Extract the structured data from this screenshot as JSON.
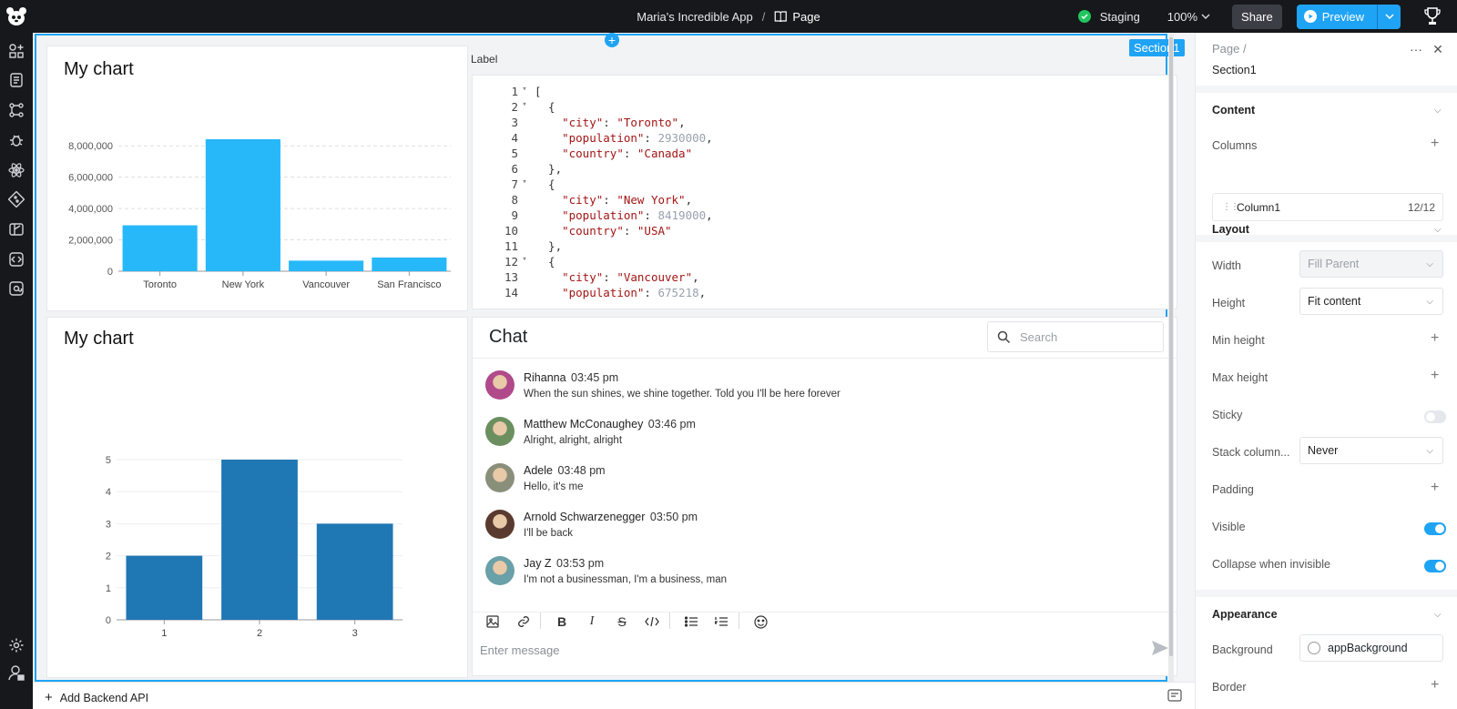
{
  "topbar": {
    "app_name": "Maria's Incredible App",
    "separator": "/",
    "page_name": "Page",
    "environment": "Staging",
    "zoom": "100%",
    "share_label": "Share",
    "preview_label": "Preview"
  },
  "canvas": {
    "section_badge": "Section1",
    "code_label": "Label"
  },
  "chart1_card": {
    "title": "My chart"
  },
  "chart2_card": {
    "title": "My chart"
  },
  "chart_data": [
    {
      "type": "bar",
      "categories": [
        "Toronto",
        "New York",
        "Vancouver",
        "San Francisco"
      ],
      "values": [
        2930000,
        8419000,
        675218,
        874961
      ],
      "ylim": [
        0,
        9000000
      ],
      "yticks": [
        "0",
        "2,000,000",
        "4,000,000",
        "6,000,000",
        "8,000,000"
      ],
      "ytick_values": [
        0,
        2000000,
        4000000,
        6000000,
        8000000
      ],
      "grid": true,
      "color": "#27b8fa"
    },
    {
      "type": "bar",
      "categories": [
        "1",
        "2",
        "3"
      ],
      "values": [
        2,
        5,
        3
      ],
      "ylim": [
        0,
        5
      ],
      "yticks": [
        "0",
        "1",
        "2",
        "3",
        "4",
        "5"
      ],
      "ytick_values": [
        0,
        1,
        2,
        3,
        4,
        5
      ],
      "grid": true,
      "color": "#1f77b4"
    }
  ],
  "code": {
    "lines": [
      {
        "n": "1",
        "fold": true,
        "t": "["
      },
      {
        "n": "2",
        "fold": true,
        "t": "  {"
      },
      {
        "n": "3",
        "fold": false,
        "k": "\"city\"",
        "v": "\"Toronto\"",
        "vt": "s",
        "end": ","
      },
      {
        "n": "4",
        "fold": false,
        "k": "\"population\"",
        "v": "2930000",
        "vt": "n",
        "end": ","
      },
      {
        "n": "5",
        "fold": false,
        "k": "\"country\"",
        "v": "\"Canada\"",
        "vt": "s",
        "end": ""
      },
      {
        "n": "6",
        "fold": false,
        "t": "  },"
      },
      {
        "n": "7",
        "fold": true,
        "t": "  {"
      },
      {
        "n": "8",
        "fold": false,
        "k": "\"city\"",
        "v": "\"New York\"",
        "vt": "s",
        "end": ","
      },
      {
        "n": "9",
        "fold": false,
        "k": "\"population\"",
        "v": "8419000",
        "vt": "n",
        "end": ","
      },
      {
        "n": "10",
        "fold": false,
        "k": "\"country\"",
        "v": "\"USA\"",
        "vt": "s",
        "end": ""
      },
      {
        "n": "11",
        "fold": false,
        "t": "  },"
      },
      {
        "n": "12",
        "fold": true,
        "t": "  {"
      },
      {
        "n": "13",
        "fold": false,
        "k": "\"city\"",
        "v": "\"Vancouver\"",
        "vt": "s",
        "end": ","
      },
      {
        "n": "14",
        "fold": false,
        "k": "\"population\"",
        "v": "675218",
        "vt": "n",
        "end": ","
      }
    ]
  },
  "chat": {
    "title": "Chat",
    "search_placeholder": "Search",
    "composer_placeholder": "Enter message",
    "messages": [
      {
        "name": "Rihanna",
        "time": "03:45 pm",
        "text": "When the sun shines, we shine together. Told you I'll be here forever",
        "color": "#b04a8a"
      },
      {
        "name": "Matthew McConaughey",
        "time": "03:46 pm",
        "text": "Alright, alright, alright",
        "color": "#6b8f5e"
      },
      {
        "name": "Adele",
        "time": "03:48 pm",
        "text": "Hello, it's me",
        "color": "#8a8f7a"
      },
      {
        "name": "Arnold Schwarzenegger",
        "time": "03:50 pm",
        "text": "I'll be back",
        "color": "#5a3a2e"
      },
      {
        "name": "Jay Z",
        "time": "03:53 pm",
        "text": "I'm not a businessman, I'm a business, man",
        "color": "#6aa0a8"
      }
    ]
  },
  "panel": {
    "crumb": "Page  /",
    "section_name": "Section1",
    "content_head": "Content",
    "columns_label": "Columns",
    "column1_name": "Column1",
    "column1_size": "12/12",
    "layout_head": "Layout",
    "width_label": "Width",
    "width_value": "Fill Parent",
    "height_label": "Height",
    "height_value": "Fit content",
    "min_height_label": "Min height",
    "max_height_label": "Max height",
    "sticky_label": "Sticky",
    "stack_label": "Stack column...",
    "stack_value": "Never",
    "padding_label": "Padding",
    "visible_label": "Visible",
    "collapse_label": "Collapse when invisible",
    "appearance_head": "Appearance",
    "background_label": "Background",
    "background_value": "appBackground",
    "border_label": "Border"
  },
  "bottombar": {
    "add_api_label": "Add Backend API"
  }
}
